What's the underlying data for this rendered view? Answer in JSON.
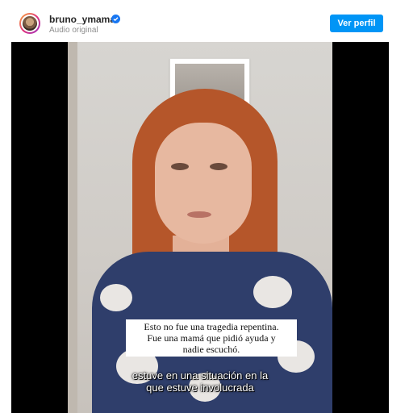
{
  "post": {
    "username": "bruno_ymama",
    "audio_label": "Audio original",
    "view_profile_label": "Ver perfil",
    "verified_icon": "verified-badge-icon",
    "accent": "#0095f6"
  },
  "video": {
    "caption_lines": [
      "Esto no fue una tragedia repentina.",
      "Fue una mamá que pidió ayuda y",
      "nadie escuchó."
    ],
    "subtitle_lines": [
      "estuve en una situación en la",
      "que estuve involucrada"
    ]
  }
}
